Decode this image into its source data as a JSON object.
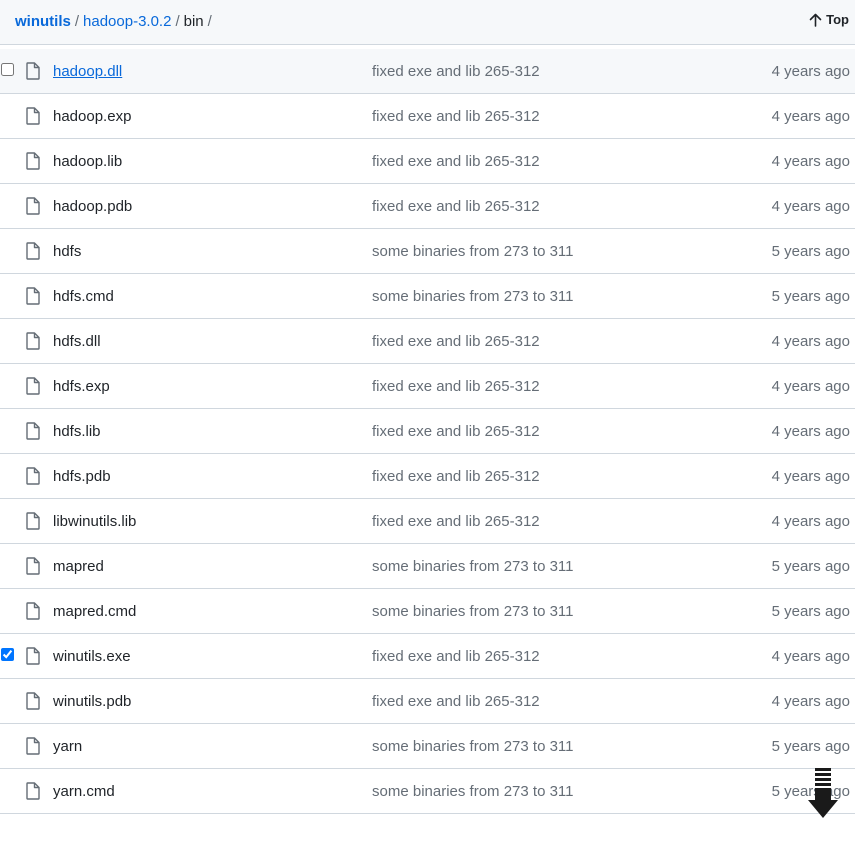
{
  "breadcrumb": {
    "repo": "winutils",
    "folder": "hadoop-3.0.2",
    "current": "bin",
    "separator": "/"
  },
  "top_button": {
    "label": "Top",
    "icon": "arrow-up-icon"
  },
  "files": [
    {
      "name": "hadoop.dll",
      "message": "fixed exe and lib 265-312",
      "age": "4 years ago",
      "checked": false,
      "hovered": true
    },
    {
      "name": "hadoop.exp",
      "message": "fixed exe and lib 265-312",
      "age": "4 years ago"
    },
    {
      "name": "hadoop.lib",
      "message": "fixed exe and lib 265-312",
      "age": "4 years ago"
    },
    {
      "name": "hadoop.pdb",
      "message": "fixed exe and lib 265-312",
      "age": "4 years ago"
    },
    {
      "name": "hdfs",
      "message": "some binaries from 273 to 311",
      "age": "5 years ago"
    },
    {
      "name": "hdfs.cmd",
      "message": "some binaries from 273 to 311",
      "age": "5 years ago"
    },
    {
      "name": "hdfs.dll",
      "message": "fixed exe and lib 265-312",
      "age": "4 years ago"
    },
    {
      "name": "hdfs.exp",
      "message": "fixed exe and lib 265-312",
      "age": "4 years ago"
    },
    {
      "name": "hdfs.lib",
      "message": "fixed exe and lib 265-312",
      "age": "4 years ago"
    },
    {
      "name": "hdfs.pdb",
      "message": "fixed exe and lib 265-312",
      "age": "4 years ago"
    },
    {
      "name": "libwinutils.lib",
      "message": "fixed exe and lib 265-312",
      "age": "4 years ago"
    },
    {
      "name": "mapred",
      "message": "some binaries from 273 to 311",
      "age": "5 years ago"
    },
    {
      "name": "mapred.cmd",
      "message": "some binaries from 273 to 311",
      "age": "5 years ago"
    },
    {
      "name": "winutils.exe",
      "message": "fixed exe and lib 265-312",
      "age": "4 years ago",
      "checked": true
    },
    {
      "name": "winutils.pdb",
      "message": "fixed exe and lib 265-312",
      "age": "4 years ago"
    },
    {
      "name": "yarn",
      "message": "some binaries from 273 to 311",
      "age": "5 years ago"
    },
    {
      "name": "yarn.cmd",
      "message": "some binaries from 273 to 311",
      "age": "5 years ago"
    }
  ],
  "icons": {
    "file": "file-icon",
    "scroll": "scroll-down-arrow-icon"
  },
  "colors": {
    "link": "#0969da",
    "muted": "#656d76",
    "text": "#1f2328",
    "border": "#d0d7de",
    "header_bg": "#f6f8fa"
  }
}
